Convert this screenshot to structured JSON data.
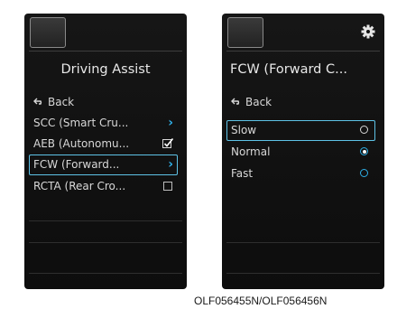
{
  "left_panel": {
    "title": "Driving Assist",
    "back_label": "Back",
    "items": [
      {
        "label": "SCC (Smart Cru...",
        "control": "chevron"
      },
      {
        "label": "AEB (Autonomu...",
        "control": "checkbox",
        "checked": true
      },
      {
        "label": "FCW (Forward...",
        "control": "chevron",
        "selected": true
      },
      {
        "label": "RCTA (Rear Cro...",
        "control": "checkbox",
        "checked": false
      }
    ]
  },
  "right_panel": {
    "title": "FCW (Forward C...",
    "back_label": "Back",
    "options": [
      {
        "label": "Slow",
        "selected_focus": true,
        "checked": false
      },
      {
        "label": "Normal",
        "checked": true
      },
      {
        "label": "Fast",
        "checked": false
      }
    ]
  },
  "caption": "OLF056455N/OLF056456N",
  "icons": {
    "back": "back-arrow-icon",
    "chevron": "chevron-right-icon",
    "check": "check-icon",
    "settings": "gear-icon"
  },
  "colors": {
    "accent": "#2fb0e8",
    "panel_bg": "#111111",
    "text": "#d8d8d8"
  }
}
